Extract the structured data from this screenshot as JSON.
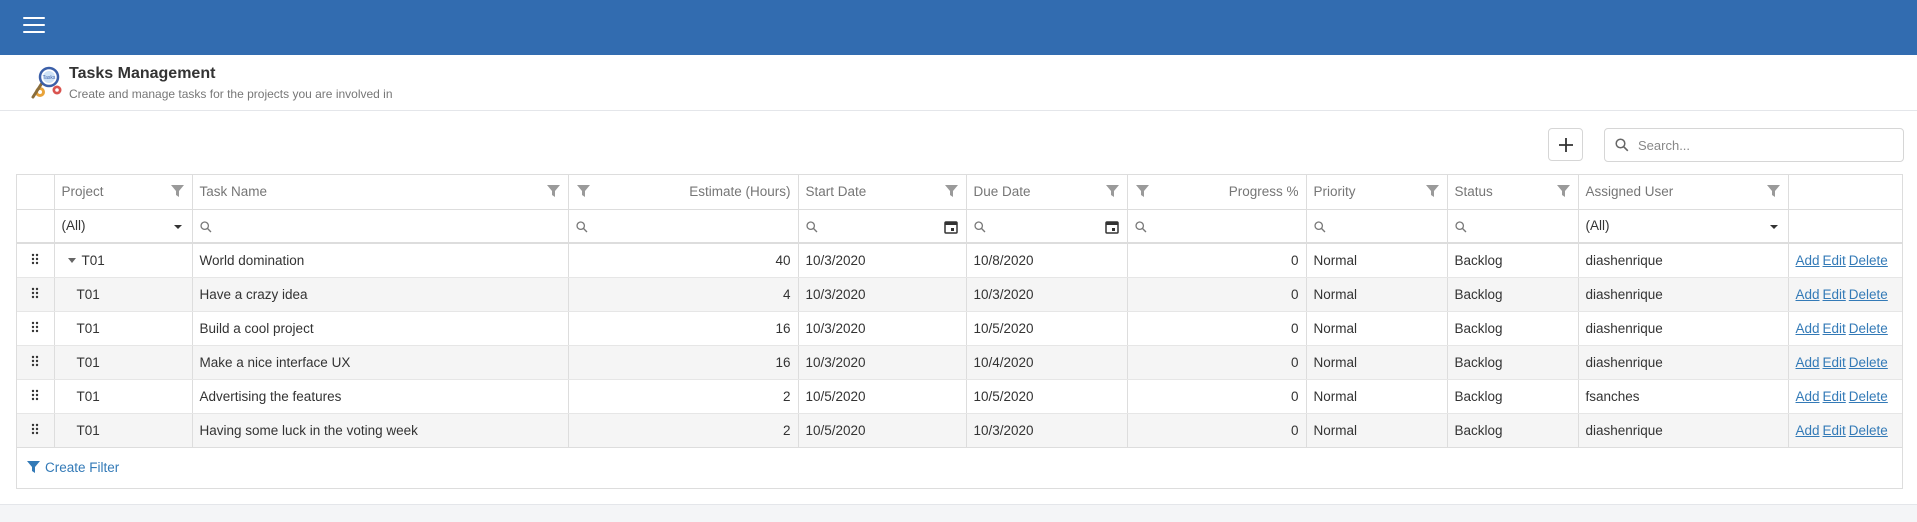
{
  "header": {
    "title": "Tasks Management",
    "subtitle": "Create and manage tasks for the projects you are involved in"
  },
  "toolbar": {
    "search_placeholder": "Search..."
  },
  "grid": {
    "columns": {
      "project": "Project",
      "task_name": "Task Name",
      "estimate": "Estimate (Hours)",
      "start_date": "Start Date",
      "due_date": "Due Date",
      "progress": "Progress %",
      "priority": "Priority",
      "status": "Status",
      "assigned_user": "Assigned User"
    },
    "filters": {
      "project": "(All)",
      "assigned_user": "(All)"
    },
    "rows": [
      {
        "project": "T01",
        "task": "World domination",
        "estimate": "40",
        "start": "10/3/2020",
        "due": "10/8/2020",
        "progress": "0",
        "priority": "Normal",
        "status": "Backlog",
        "user": "diashenrique"
      },
      {
        "project": "T01",
        "task": "Have a crazy idea",
        "estimate": "4",
        "start": "10/3/2020",
        "due": "10/3/2020",
        "progress": "0",
        "priority": "Normal",
        "status": "Backlog",
        "user": "diashenrique"
      },
      {
        "project": "T01",
        "task": "Build a cool project",
        "estimate": "16",
        "start": "10/3/2020",
        "due": "10/5/2020",
        "progress": "0",
        "priority": "Normal",
        "status": "Backlog",
        "user": "diashenrique"
      },
      {
        "project": "T01",
        "task": "Make a nice interface UX",
        "estimate": "16",
        "start": "10/3/2020",
        "due": "10/4/2020",
        "progress": "0",
        "priority": "Normal",
        "status": "Backlog",
        "user": "diashenrique"
      },
      {
        "project": "T01",
        "task": "Advertising the features",
        "estimate": "2",
        "start": "10/5/2020",
        "due": "10/5/2020",
        "progress": "0",
        "priority": "Normal",
        "status": "Backlog",
        "user": "fsanches"
      },
      {
        "project": "T01",
        "task": "Having some luck in the voting week",
        "estimate": "2",
        "start": "10/5/2020",
        "due": "10/3/2020",
        "progress": "0",
        "priority": "Normal",
        "status": "Backlog",
        "user": "diashenrique"
      }
    ],
    "row_actions": {
      "add": "Add",
      "edit": "Edit",
      "delete": "Delete"
    }
  },
  "footer": {
    "create_filter": "Create Filter"
  },
  "icons": {
    "menu": "hamburger-menu-icon",
    "logo": "tasks-magnifier-gear-icon",
    "add": "plus-icon",
    "search": "search-icon",
    "filter": "funnel-icon",
    "calendar": "calendar-icon",
    "drag": "drag-handle-icon"
  },
  "colors": {
    "topbar": "#326cb0",
    "link": "#337ab7"
  }
}
